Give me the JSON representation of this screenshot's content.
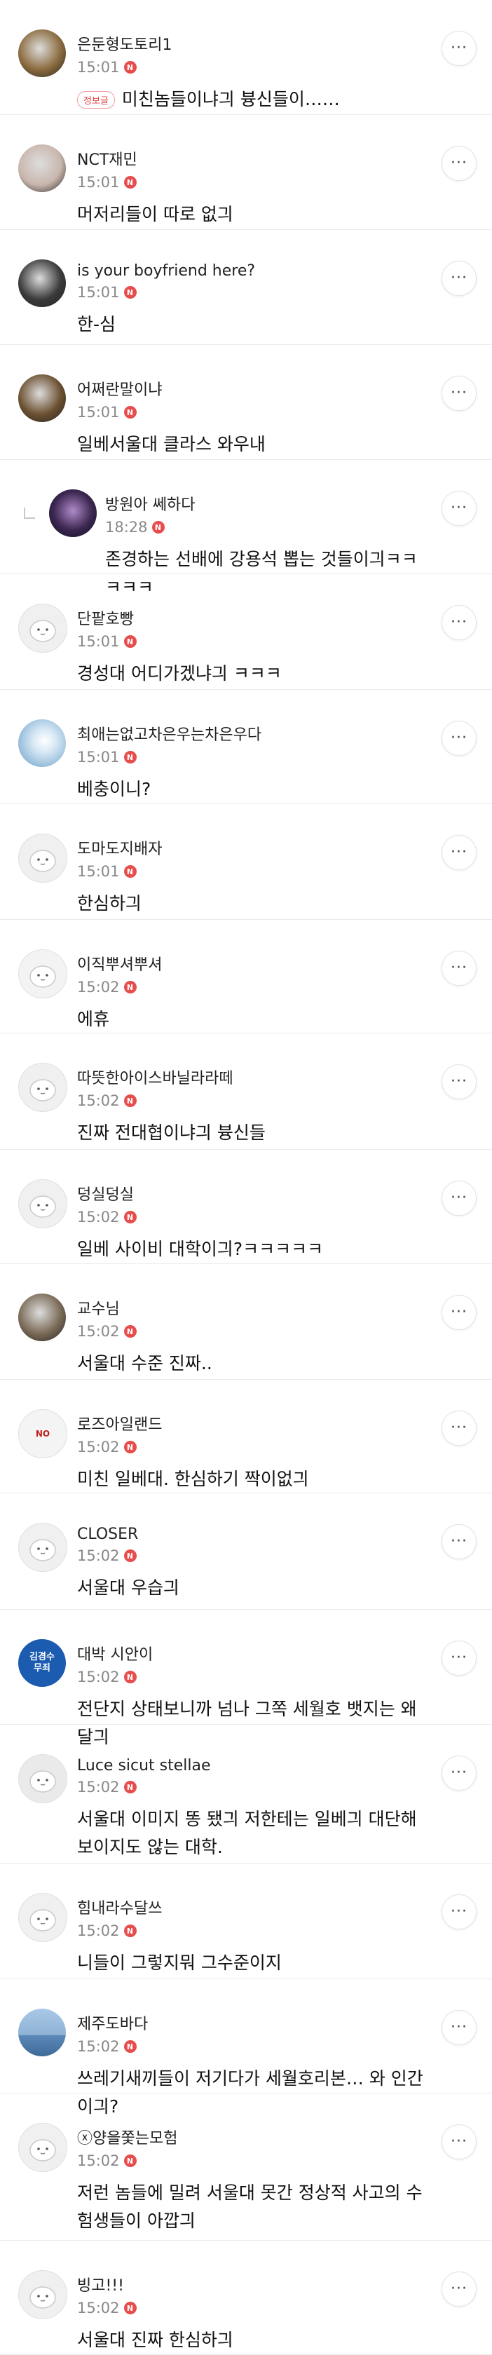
{
  "comments": [
    {
      "nickname": "은둔형도토리1",
      "time": "15:01",
      "new_badge": "N",
      "tag": "정보글",
      "body": "미친놈들이냐긔 븅신들이……",
      "avatar": "photo-wolf",
      "avatar_color": "#8b6b3e",
      "reply": false
    },
    {
      "nickname": "NCT재민",
      "time": "15:01",
      "new_badge": "N",
      "body": "머저리들이 따로 없긔",
      "avatar": "photo-idol",
      "avatar_color": "#c9b7ad",
      "reply": false
    },
    {
      "nickname": "is your boyfriend here?",
      "time": "15:01",
      "new_badge": "N",
      "body": "한-심",
      "avatar": "photo-face",
      "avatar_color": "#3a3a3a",
      "reply": false
    },
    {
      "nickname": "어쩌란말이냐",
      "time": "15:01",
      "new_badge": "N",
      "body": "일베서울대 클라스 와우내",
      "avatar": "photo-man",
      "avatar_color": "#6b5030",
      "reply": false
    },
    {
      "nickname": "방원아 쎄하다",
      "time": "18:28",
      "new_badge": "N",
      "body": "존경하는 선배에 강용석 뽑는 것들이긔ㅋㅋㅋㅋㅋ",
      "avatar": "photo-dark",
      "avatar_color": "#3b2650",
      "reply": true
    },
    {
      "nickname": "단팥호빵",
      "time": "15:01",
      "new_badge": "N",
      "body": "경성대 어디가겠냐긔 ㅋㅋㅋ",
      "avatar": "default-bun",
      "avatar_color": "#f0f0f0",
      "reply": false
    },
    {
      "nickname": "최애는없고차은우는차은우다",
      "time": "15:01",
      "new_badge": "N",
      "body": "베충이니?",
      "avatar": "photo-sky",
      "avatar_color": "#8fb8d8",
      "reply": false
    },
    {
      "nickname": "도마도지배자",
      "time": "15:01",
      "new_badge": "N",
      "body": "한심하긔",
      "avatar": "default-doll",
      "avatar_color": "#f0f0f0",
      "reply": false
    },
    {
      "nickname": "이직뿌셔뿌셔",
      "time": "15:02",
      "new_badge": "N",
      "body": "에휴",
      "avatar": "default-blob",
      "avatar_color": "#f3f3f3",
      "reply": false
    },
    {
      "nickname": "따뜻한아이스바닐라라떼",
      "time": "15:02",
      "new_badge": "N",
      "body": "진짜 전대협이냐긔 븅신들",
      "avatar": "default-bun",
      "avatar_color": "#f0f0f0",
      "reply": false
    },
    {
      "nickname": "덩실덩실",
      "time": "15:02",
      "new_badge": "N",
      "body": "일베 사이비 대학이긔?ㅋㅋㅋㅋㅋ",
      "avatar": "default-bunny",
      "avatar_color": "#f0f0f0",
      "reply": false
    },
    {
      "nickname": "교수님",
      "time": "15:02",
      "new_badge": "N",
      "body": "서울대 수준 진짜..",
      "avatar": "photo-seal",
      "avatar_color": "#7a6a56",
      "reply": false
    },
    {
      "nickname": "로즈아일랜드",
      "time": "15:02",
      "new_badge": "N",
      "body": "미친 일베대. 한심하기 짝이없긔",
      "avatar": "logo-text",
      "avatar_color": "#f4f4f4",
      "avatar_text": "NO",
      "reply": false
    },
    {
      "nickname": "CLOSER",
      "time": "15:02",
      "new_badge": "N",
      "body": "서울대 우습긔",
      "avatar": "default-penguin",
      "avatar_color": "#f0f0f0",
      "reply": false
    },
    {
      "nickname": "대박 시안이",
      "time": "15:02",
      "new_badge": "N",
      "body": "전단지 상태보니까 넘나 그쪽 세월호 뱃지는 왜 달긔",
      "avatar": "badge-blue",
      "avatar_color": "#1b5bb0",
      "avatar_text": "김경수\n무죄",
      "reply": false
    },
    {
      "nickname": "Luce sicut stellae",
      "time": "15:02",
      "new_badge": "N",
      "body": "서울대 이미지 똥 됐긔 저한테는 일베긔 대단해보이지도 않는 대학.",
      "avatar": "default-bear",
      "avatar_color": "#eaeaea",
      "reply": false
    },
    {
      "nickname": "힘내라수달쓰",
      "time": "15:02",
      "new_badge": "N",
      "body": "니들이 그렇지뭐 그수준이지",
      "avatar": "default-bunny",
      "avatar_color": "#f0f0f0",
      "reply": false
    },
    {
      "nickname": "제주도바다",
      "time": "15:02",
      "new_badge": "N",
      "body": "쓰레기새끼들이 저기다가 세월호리본… 와 인간이긔?",
      "avatar": "photo-sea",
      "avatar_color": "#5d89b8",
      "reply": false
    },
    {
      "nickname": "ⓧ양을쫓는모험",
      "time": "15:02",
      "new_badge": "N",
      "body": "저런 놈들에 밀려 서울대 못간 정상적 사고의 수험생들이 아깝긔",
      "avatar": "default-bunny",
      "avatar_color": "#f0f0f0",
      "reply": false
    },
    {
      "nickname": "빙고!!!",
      "time": "15:02",
      "new_badge": "N",
      "body": "서울대 진짜 한심하긔",
      "avatar": "default-blob",
      "avatar_color": "#f0f0f0",
      "reply": false
    }
  ],
  "more_button_label": "···",
  "icons": {
    "more": "more-dots-icon",
    "reply": "reply-arrow-icon",
    "new": "new-badge-icon"
  }
}
